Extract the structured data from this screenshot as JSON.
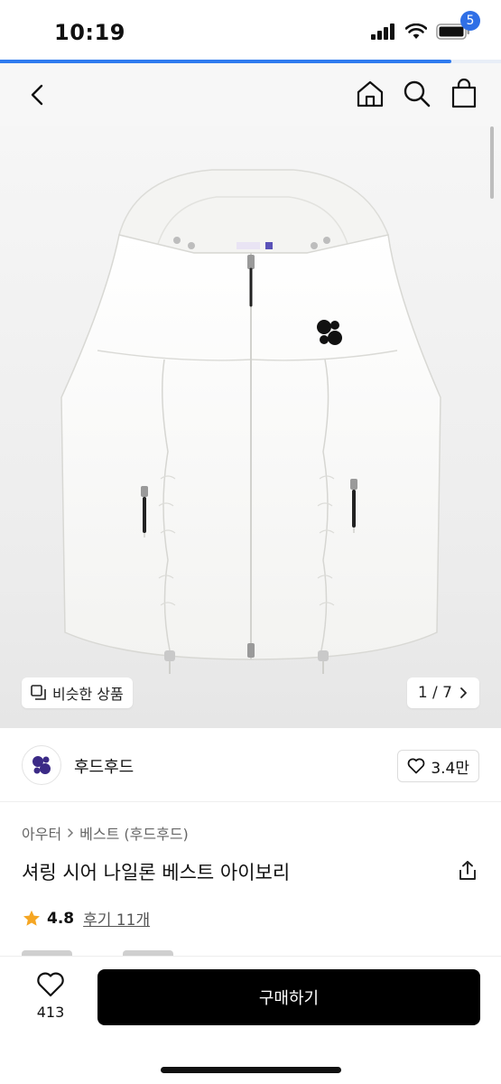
{
  "status_bar": {
    "time": "10:19",
    "progress_fraction": 0.9
  },
  "nav": {
    "cart_count": "5"
  },
  "image": {
    "similar_label": "비슷한 상품",
    "pager": "1 / 7"
  },
  "store": {
    "name": "후드후드",
    "likes": "3.4만"
  },
  "breadcrumb": {
    "category": "아우터",
    "subcategory": "베스트 (후드후드)"
  },
  "product": {
    "title": "셔링 시어 나일론 베스트 아이보리",
    "rating": "4.8",
    "reviews": "후기 11개"
  },
  "bottom": {
    "wish_count": "413",
    "buy_label": "구매하기"
  },
  "colors": {
    "accent": "#2f6fe6",
    "buy_button": "#000000",
    "star": "#f5a623",
    "brand_logo": "#3b2a86"
  }
}
